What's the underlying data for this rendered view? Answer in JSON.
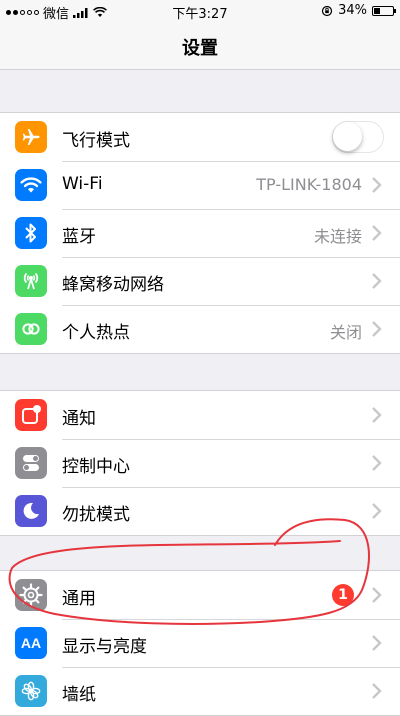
{
  "status_bar": {
    "carrier": "微信",
    "time": "下午3:27",
    "battery_percent": "34%",
    "battery_level": 0.34
  },
  "nav": {
    "title": "设置"
  },
  "groups": [
    {
      "rows": [
        {
          "label": "飞行模式",
          "icon": "airplane-icon",
          "color": "#ff9500",
          "control": "toggle",
          "toggle_on": false
        },
        {
          "label": "Wi-Fi",
          "icon": "wifi-icon",
          "color": "#007aff",
          "value": "TP-LINK-1804"
        },
        {
          "label": "蓝牙",
          "icon": "bluetooth-icon",
          "color": "#007aff",
          "value": "未连接"
        },
        {
          "label": "蜂窝移动网络",
          "icon": "cellular-icon",
          "color": "#4cd964"
        },
        {
          "label": "个人热点",
          "icon": "hotspot-icon",
          "color": "#4cd964",
          "value": "关闭"
        }
      ]
    },
    {
      "rows": [
        {
          "label": "通知",
          "icon": "notifications-icon",
          "color": "#ff3b30"
        },
        {
          "label": "控制中心",
          "icon": "control-center-icon",
          "color": "#8e8e93"
        },
        {
          "label": "勿扰模式",
          "icon": "moon-icon",
          "color": "#5856d6"
        }
      ]
    },
    {
      "rows": [
        {
          "label": "通用",
          "icon": "gear-icon",
          "color": "#8e8e93",
          "badge": "1"
        },
        {
          "label": "显示与亮度",
          "icon": "display-brightness-icon",
          "color": "#007aff",
          "icon_text": "AA"
        },
        {
          "label": "墙纸",
          "icon": "wallpaper-icon",
          "color": "#34aadc"
        }
      ]
    }
  ]
}
